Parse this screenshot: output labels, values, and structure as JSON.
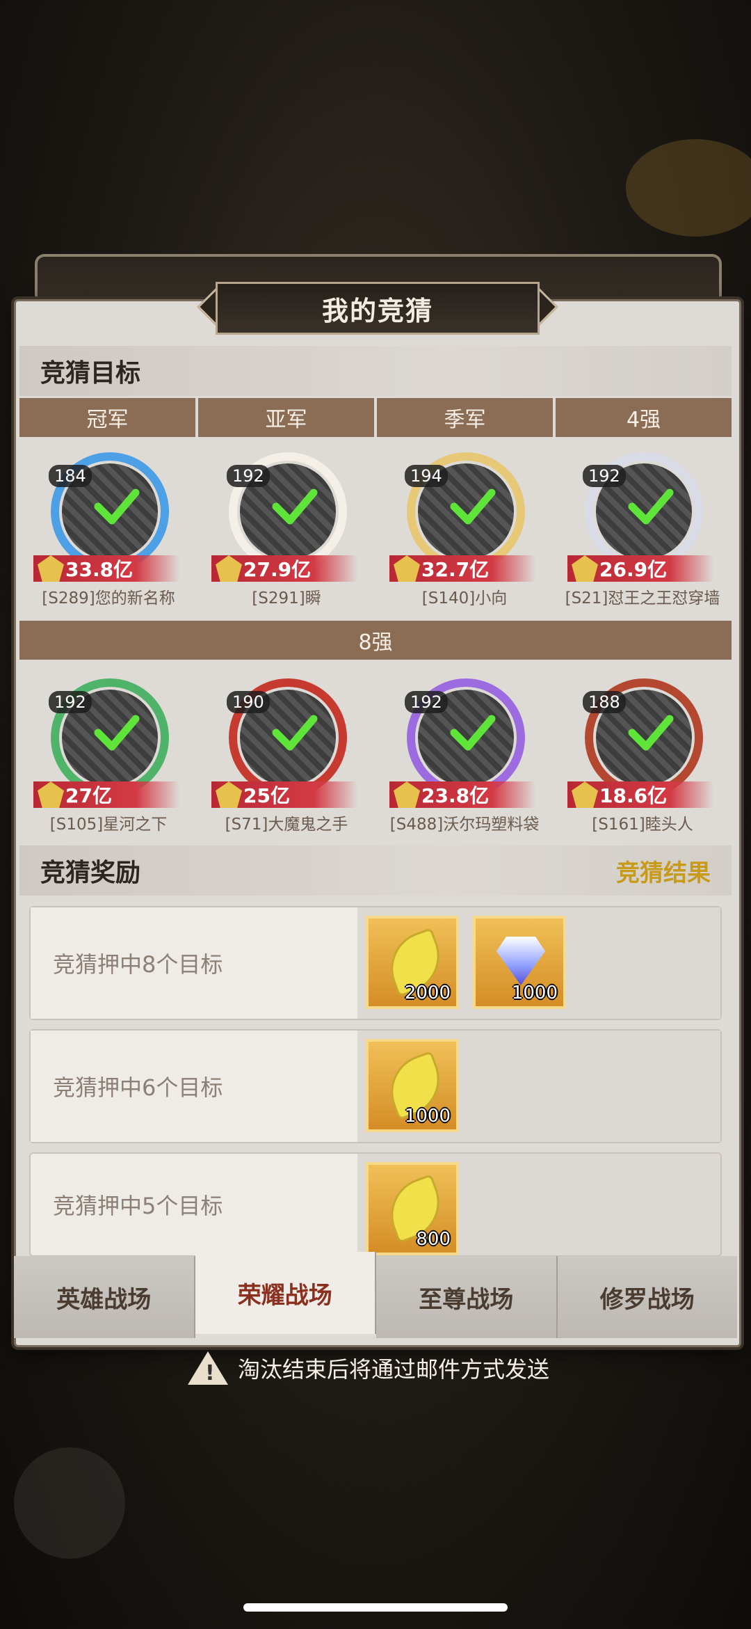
{
  "title": "我的竞猜",
  "targets_header": "竞猜目标",
  "categories": [
    "冠军",
    "亚军",
    "季军",
    "4强"
  ],
  "eight_label": "8强",
  "heroes_top": [
    {
      "level": "184",
      "power": "33.8亿",
      "name": "[S289]您的新名称",
      "ring": "#4da0e6"
    },
    {
      "level": "192",
      "power": "27.9亿",
      "name": "[S291]瞬",
      "ring": "#f4f0e8"
    },
    {
      "level": "194",
      "power": "32.7亿",
      "name": "[S140]小向",
      "ring": "#e6c877"
    },
    {
      "level": "192",
      "power": "26.9亿",
      "name": "[S21]怼王之王怼穿墙",
      "ring": "#d9dbe6"
    }
  ],
  "heroes_eight": [
    {
      "level": "192",
      "power": "27亿",
      "name": "[S105]星河之下",
      "ring": "#4fb36a"
    },
    {
      "level": "190",
      "power": "25亿",
      "name": "[S71]大魔鬼之手",
      "ring": "#c73a2f"
    },
    {
      "level": "192",
      "power": "23.8亿",
      "name": "[S488]沃尔玛塑料袋",
      "ring": "#9d6be0"
    },
    {
      "level": "188",
      "power": "18.6亿",
      "name": "[S161]睦头人",
      "ring": "#b4472f"
    }
  ],
  "rewards_header": "竞猜奖励",
  "result_link": "竞猜结果",
  "rewards": [
    {
      "label": "竞猜押中8个目标",
      "items": [
        {
          "type": "leaf-icon",
          "qty": "2000"
        },
        {
          "type": "gem-icon",
          "qty": "1000"
        }
      ]
    },
    {
      "label": "竞猜押中6个目标",
      "items": [
        {
          "type": "leaf-icon",
          "qty": "1000"
        }
      ]
    },
    {
      "label": "竞猜押中5个目标",
      "items": [
        {
          "type": "leaf-icon",
          "qty": "800"
        }
      ]
    }
  ],
  "tabs": [
    "英雄战场",
    "荣耀战场",
    "至尊战场",
    "修罗战场"
  ],
  "active_tab": "荣耀战场",
  "notice": "淘汰结束后将通过邮件方式发送"
}
